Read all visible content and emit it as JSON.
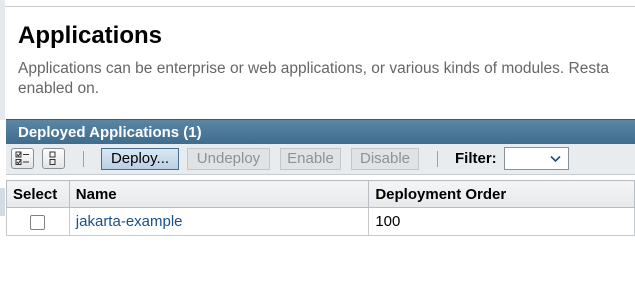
{
  "page": {
    "title": "Applications",
    "description": "Applications can be enterprise or web applications, or various kinds of modules. Resta enabled on."
  },
  "panel": {
    "title": "Deployed Applications (1)"
  },
  "toolbar": {
    "select_all_icon": "select-all-icon",
    "deselect_all_icon": "deselect-all-icon",
    "deploy_label": "Deploy...",
    "undeploy_label": "Undeploy",
    "enable_label": "Enable",
    "disable_label": "Disable",
    "filter_label": "Filter:",
    "filter_value": ""
  },
  "table": {
    "columns": [
      "Select",
      "Name",
      "Deployment Order"
    ],
    "rows": [
      {
        "selected": false,
        "name": "jakarta-example",
        "deployment_order": "100"
      }
    ]
  },
  "colors": {
    "header_blue": "#3f6c8e",
    "link_blue": "#1a4f8c",
    "toolbar_bg": "#e9ecee"
  }
}
